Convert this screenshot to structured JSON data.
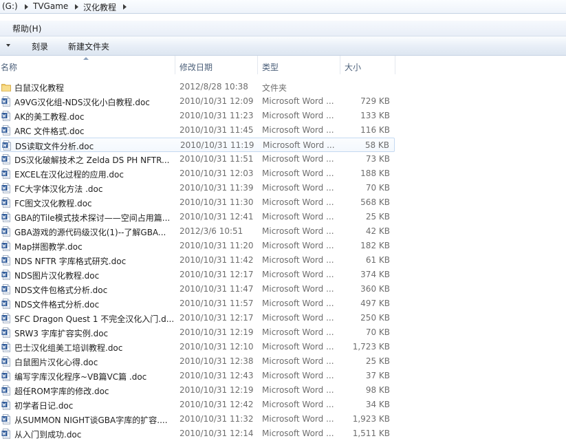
{
  "address_bar": {
    "segments": [
      "(G:)",
      "TVGame",
      "汉化教程"
    ]
  },
  "menu_bar": {
    "help": "帮助(H)"
  },
  "toolbar": {
    "burn": "刻录",
    "new_folder": "新建文件夹"
  },
  "columns": {
    "name": "名称",
    "modified": "修改日期",
    "type": "类型",
    "size": "大小"
  },
  "files": [
    {
      "name": "白鼠汉化教程",
      "date": "2012/8/28 10:38",
      "type": "文件夹",
      "size": "",
      "icon": "folder-icon"
    },
    {
      "name": "A9VG汉化组-NDS汉化小白教程.doc",
      "date": "2010/10/31 12:09",
      "type": "Microsoft Word ...",
      "size": "729 KB",
      "icon": "word-doc-icon"
    },
    {
      "name": "AK的美工教程.doc",
      "date": "2010/10/31 11:23",
      "type": "Microsoft Word ...",
      "size": "133 KB",
      "icon": "word-doc-icon"
    },
    {
      "name": "ARC 文件格式.doc",
      "date": "2010/10/31 11:45",
      "type": "Microsoft Word ...",
      "size": "116 KB",
      "icon": "word-doc-icon"
    },
    {
      "name": "DS读取文件分析.doc",
      "date": "2010/10/31 11:19",
      "type": "Microsoft Word ...",
      "size": "58 KB",
      "icon": "word-doc-icon"
    },
    {
      "name": "DS汉化破解技术之 Zelda DS PH NFTR...",
      "date": "2010/10/31 11:51",
      "type": "Microsoft Word ...",
      "size": "73 KB",
      "icon": "word-doc-icon"
    },
    {
      "name": "EXCEL在汉化过程的应用.doc",
      "date": "2010/10/31 12:03",
      "type": "Microsoft Word ...",
      "size": "188 KB",
      "icon": "word-doc-icon"
    },
    {
      "name": "FC大字体汉化方法 .doc",
      "date": "2010/10/31 11:39",
      "type": "Microsoft Word ...",
      "size": "70 KB",
      "icon": "word-doc-icon"
    },
    {
      "name": "FC图文汉化教程.doc",
      "date": "2010/10/31 11:30",
      "type": "Microsoft Word ...",
      "size": "568 KB",
      "icon": "word-doc-icon"
    },
    {
      "name": "GBA的Tile模式技术探讨——空间占用篇...",
      "date": "2010/10/31 12:41",
      "type": "Microsoft Word ...",
      "size": "25 KB",
      "icon": "word-doc-icon"
    },
    {
      "name": "GBA游戏的源代码级汉化(1)--了解GBA...",
      "date": "2012/3/6 10:51",
      "type": "Microsoft Word ...",
      "size": "42 KB",
      "icon": "word-doc-icon"
    },
    {
      "name": "Map拼图教学.doc",
      "date": "2010/10/31 11:20",
      "type": "Microsoft Word ...",
      "size": "182 KB",
      "icon": "word-doc-icon"
    },
    {
      "name": "NDS NFTR 字库格式研究.doc",
      "date": "2010/10/31 11:42",
      "type": "Microsoft Word ...",
      "size": "61 KB",
      "icon": "word-doc-icon"
    },
    {
      "name": "NDS图片汉化教程.doc",
      "date": "2010/10/31 12:17",
      "type": "Microsoft Word ...",
      "size": "374 KB",
      "icon": "word-doc-icon"
    },
    {
      "name": "NDS文件包格式分析.doc",
      "date": "2010/10/31 11:47",
      "type": "Microsoft Word ...",
      "size": "360 KB",
      "icon": "word-doc-icon"
    },
    {
      "name": "NDS文件格式分析.doc",
      "date": "2010/10/31 11:57",
      "type": "Microsoft Word ...",
      "size": "497 KB",
      "icon": "word-doc-icon"
    },
    {
      "name": "SFC Dragon Quest 1 不完全汉化入门.d...",
      "date": "2010/10/31 12:17",
      "type": "Microsoft Word ...",
      "size": "250 KB",
      "icon": "word-doc-icon"
    },
    {
      "name": "SRW3 字库扩容实例.doc",
      "date": "2010/10/31 12:19",
      "type": "Microsoft Word ...",
      "size": "70 KB",
      "icon": "word-doc-icon"
    },
    {
      "name": "巴士汉化组美工培训教程.doc",
      "date": "2010/10/31 12:10",
      "type": "Microsoft Word ...",
      "size": "1,723 KB",
      "icon": "word-doc-icon"
    },
    {
      "name": "白鼠图片汉化心得.doc",
      "date": "2010/10/31 12:38",
      "type": "Microsoft Word ...",
      "size": "25 KB",
      "icon": "word-doc-icon"
    },
    {
      "name": "编写字库汉化程序~VB篇VC篇 .doc",
      "date": "2010/10/31 12:43",
      "type": "Microsoft Word ...",
      "size": "37 KB",
      "icon": "word-doc-icon"
    },
    {
      "name": "超任ROM字库的修改.doc",
      "date": "2010/10/31 12:19",
      "type": "Microsoft Word ...",
      "size": "98 KB",
      "icon": "word-doc-icon"
    },
    {
      "name": "初学者日记.doc",
      "date": "2010/10/31 12:42",
      "type": "Microsoft Word ...",
      "size": "34 KB",
      "icon": "word-doc-icon"
    },
    {
      "name": "从SUMMON NIGHT谈GBA字库的扩容....",
      "date": "2010/10/31 11:32",
      "type": "Microsoft Word ...",
      "size": "1,923 KB",
      "icon": "word-doc-icon"
    },
    {
      "name": "从入门到成功.doc",
      "date": "2010/10/31 12:14",
      "type": "Microsoft Word ...",
      "size": "1,511 KB",
      "icon": "word-doc-icon"
    }
  ],
  "highlighted_row": 4,
  "colors": {
    "folder": "#e8b84a",
    "word_blue": "#2b5797",
    "header_text": "#4c607a",
    "secondary_text": "#6d6d6d"
  }
}
